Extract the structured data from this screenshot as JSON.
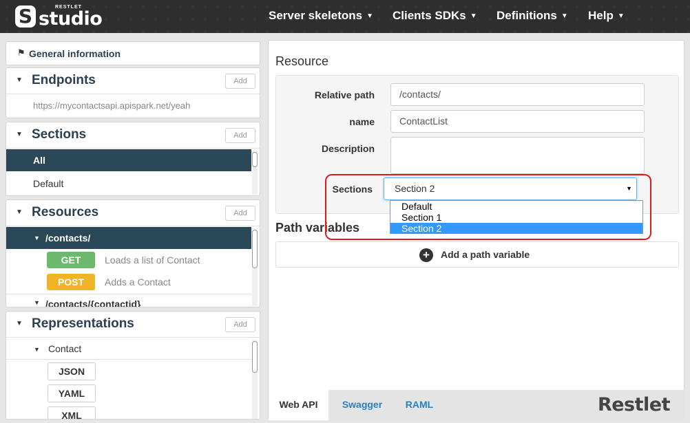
{
  "app": {
    "logo_top": "RESTLET",
    "logo_main": "studio",
    "logo_letter": "S"
  },
  "nav": {
    "items": [
      {
        "label": "Server skeletons"
      },
      {
        "label": "Clients SDKs"
      },
      {
        "label": "Definitions"
      },
      {
        "label": "Help"
      }
    ]
  },
  "sidebar": {
    "general_info": "General information",
    "endpoints": {
      "title": "Endpoints",
      "add_label": "Add",
      "url": "https://mycontactsapi.apispark.net/yeah"
    },
    "sections": {
      "title": "Sections",
      "add_label": "Add",
      "items": [
        "All",
        "Default"
      ]
    },
    "resources": {
      "title": "Resources",
      "add_label": "Add",
      "items": [
        {
          "path": "/contacts/",
          "methods": [
            {
              "verb": "GET",
              "description": "Loads a list of Contact",
              "color": "#6cb86c"
            },
            {
              "verb": "POST",
              "description": "Adds a Contact",
              "color": "#f0b429"
            }
          ]
        },
        {
          "path": "/contacts/{contactid}"
        }
      ]
    },
    "representations": {
      "title": "Representations",
      "add_label": "Add",
      "items": [
        {
          "name": "Contact",
          "formats": [
            "JSON",
            "YAML",
            "XML"
          ]
        }
      ]
    }
  },
  "main": {
    "title": "Resource",
    "form": {
      "relative_path_label": "Relative path",
      "relative_path_value": "/contacts/",
      "name_label": "name",
      "name_value": "ContactList",
      "description_label": "Description",
      "description_value": "",
      "sections_label": "Sections",
      "sections_value": "Section 2",
      "sections_options": [
        "Default",
        "Section 1",
        "Section 2"
      ]
    },
    "path_variables_title": "Path variables",
    "add_path_variable_label": "Add a path variable",
    "tabs": [
      "Web API",
      "Swagger",
      "RAML"
    ],
    "active_tab": "Web API",
    "brand_logo": "Restlet"
  },
  "colors": {
    "navbar": "#2e2e2e",
    "selected_row": "#2b4858",
    "get": "#6cb86c",
    "post": "#f0b429",
    "highlight": "#3399ff",
    "annotation": "#e01a1a",
    "tab_link": "#2a7fc1"
  }
}
